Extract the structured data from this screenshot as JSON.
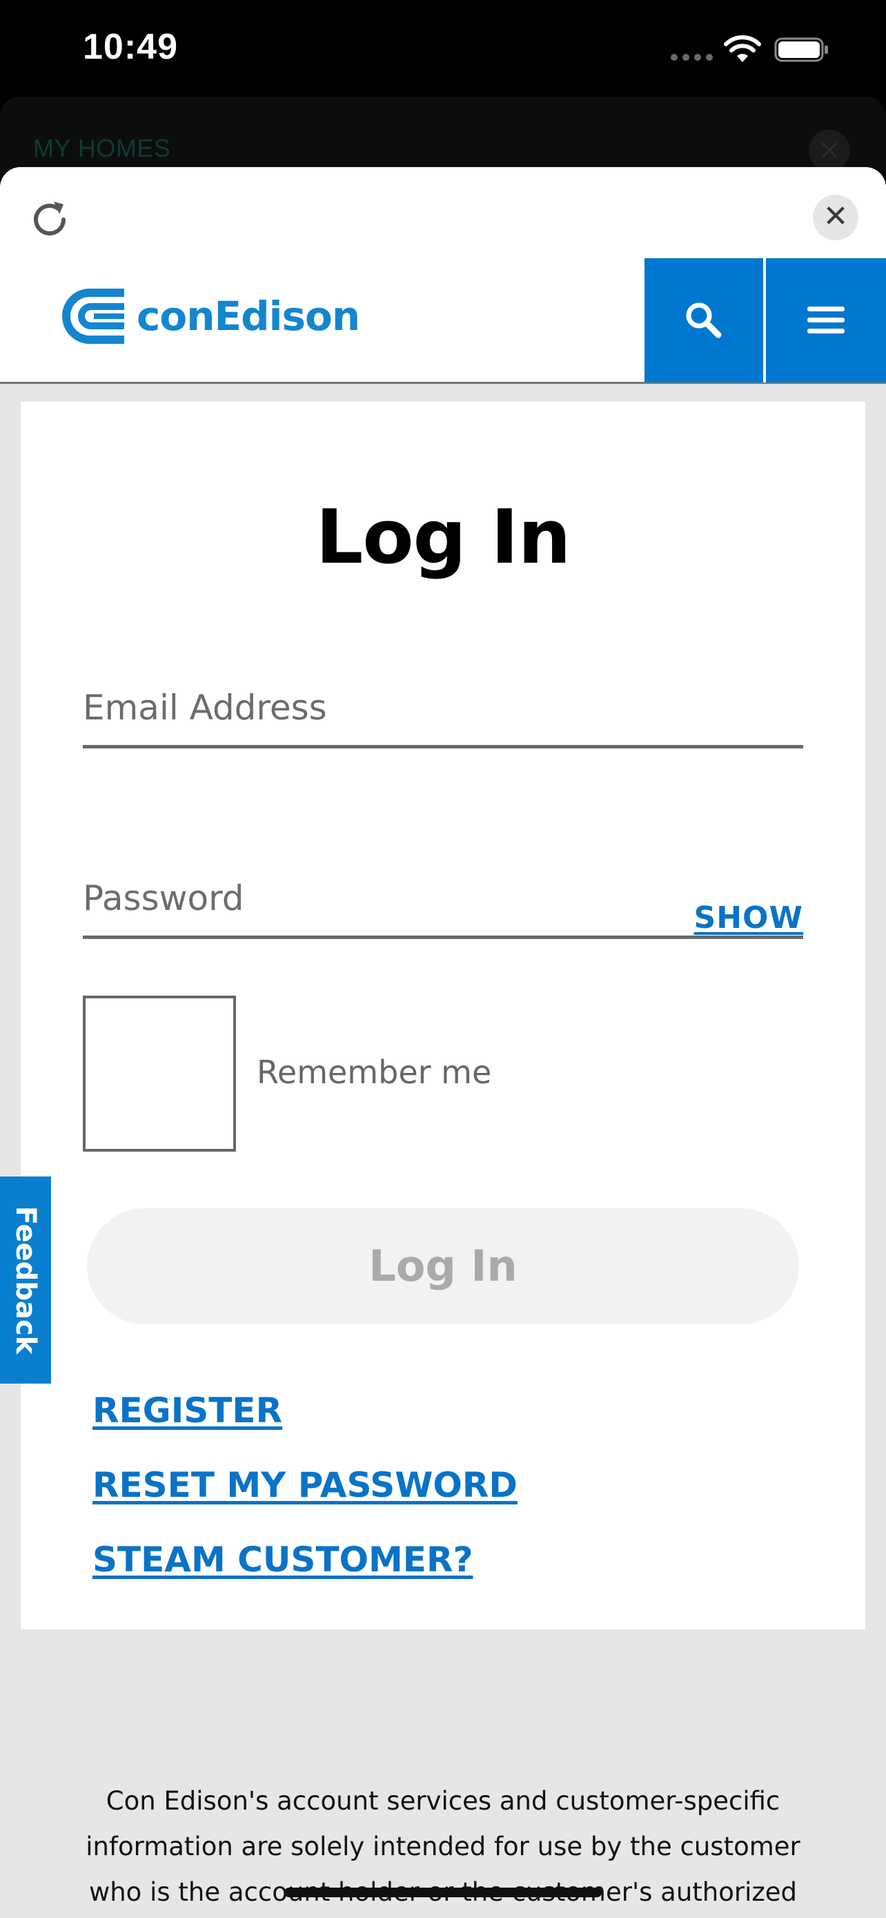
{
  "status_bar": {
    "time": "10:49"
  },
  "background_sheet": {
    "title": "MY HOMES",
    "close_glyph": "×"
  },
  "modal": {
    "close_glyph": "✕",
    "icons": {
      "reload": "reload-icon",
      "close": "close-icon"
    }
  },
  "header": {
    "logo_text": "conEdison",
    "brand_color": "#1386d0",
    "button_color": "#0078cf",
    "icons": {
      "search": "search-icon",
      "menu": "hamburger-menu-icon"
    }
  },
  "login": {
    "title": "Log In",
    "email_placeholder": "Email Address",
    "password_placeholder": "Password",
    "show_label": "SHOW",
    "remember_label": "Remember me",
    "remember_checked": false,
    "submit_label": "Log In",
    "links": {
      "register": "REGISTER",
      "reset": "RESET MY PASSWORD",
      "steam": "STEAM CUSTOMER?"
    },
    "link_color": "#0a73c7"
  },
  "feedback": {
    "label": "Feedback"
  },
  "disclaimer": {
    "text": "Con Edison's account services and customer-specific information are solely intended for use by the customer who is the account holder or the customer's authorized agent. Any"
  }
}
